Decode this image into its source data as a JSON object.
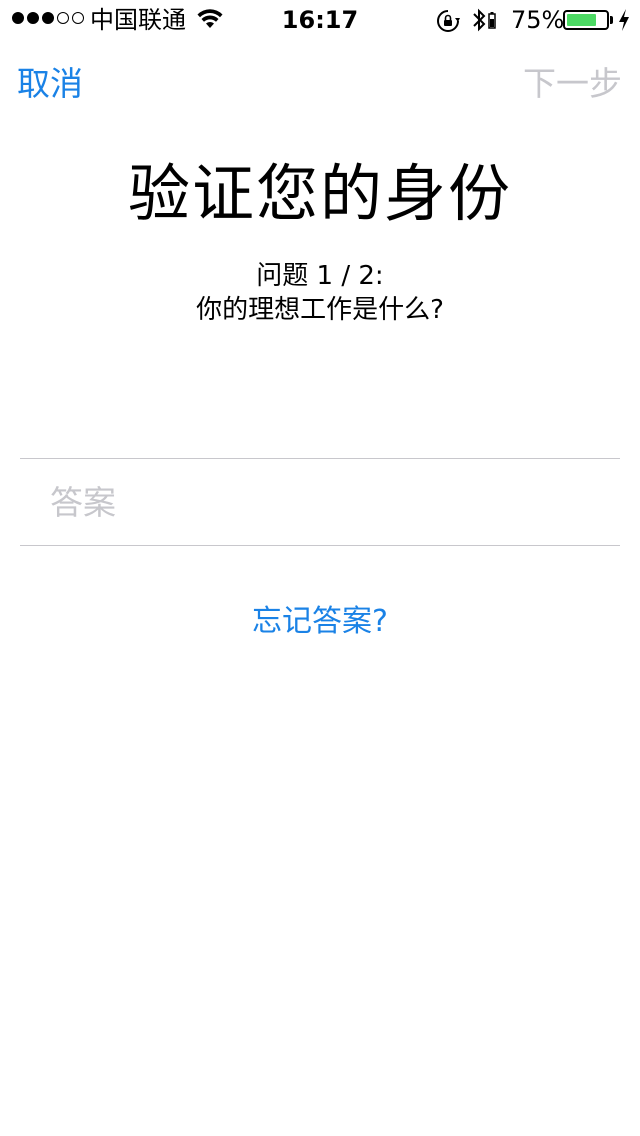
{
  "status_bar": {
    "carrier": "中国联通",
    "time": "16:17",
    "battery_percent": "75%",
    "battery_level": 0.75,
    "signal_bars_filled": 3,
    "signal_bars_total": 5
  },
  "nav": {
    "cancel_label": "取消",
    "next_label": "下一步"
  },
  "main": {
    "title": "验证您的身份",
    "question_number": "问题 1 / 2:",
    "question_text": "你的理想工作是什么?",
    "answer_placeholder": "答案",
    "forgot_label": "忘记答案?"
  },
  "colors": {
    "accent": "#1a82e6",
    "disabled": "#c7c7cc",
    "battery_fill": "#4cd964"
  }
}
